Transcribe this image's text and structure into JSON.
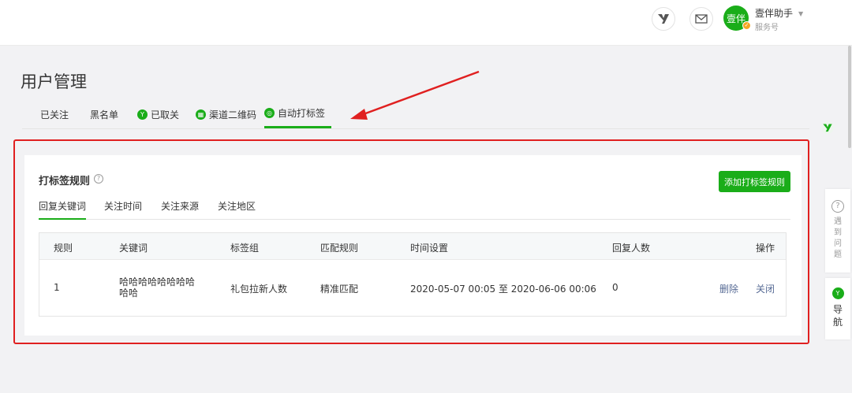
{
  "header": {
    "account_name": "壹伴助手",
    "account_type": "服务号",
    "avatar_text": "壹伴",
    "icons": [
      "yiban-logo-icon",
      "mail-icon",
      "caret-down-icon"
    ]
  },
  "page": {
    "title": "用户管理"
  },
  "tabs": [
    {
      "label": "已关注",
      "icon": ""
    },
    {
      "label": "黑名单",
      "icon": ""
    },
    {
      "label": "已取关",
      "icon": "yiban-logo-icon"
    },
    {
      "label": "渠道二维码",
      "icon": "qrcode-icon"
    },
    {
      "label": "自动打标签",
      "icon": "tag-icon",
      "active": true
    }
  ],
  "card": {
    "title": "打标签规则",
    "help_icon": "?",
    "add_button": "添加打标签规则",
    "subtabs": [
      {
        "label": "回复关键词",
        "active": true
      },
      {
        "label": "关注时间"
      },
      {
        "label": "关注来源"
      },
      {
        "label": "关注地区"
      }
    ],
    "table": {
      "columns": [
        "规则",
        "关键词",
        "标签组",
        "匹配规则",
        "时间设置",
        "回复人数",
        "操作"
      ],
      "rows": [
        {
          "rule": "1",
          "keyword": "哈哈哈哈哈哈哈哈哈哈",
          "tag_group": "礼包拉新人数",
          "match": "精准匹配",
          "time": "2020-05-07 00:05 至 2020-06-06 00:06",
          "replies": "0",
          "action_delete": "删除",
          "action_close": "关闭"
        }
      ]
    }
  },
  "side": {
    "help_icon": "?",
    "help_label": "遇到问题",
    "nav_label": "导航"
  },
  "colors": {
    "accent": "#1aad19",
    "annotation": "#e02020",
    "link": "#576b95"
  }
}
